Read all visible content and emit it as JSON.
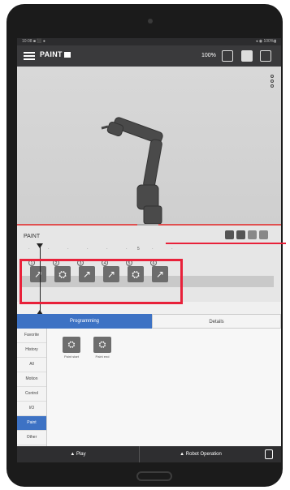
{
  "status_bar": {
    "left": "10:08 ■ ⬛ ●",
    "right": "◂ ◉ 100%▮"
  },
  "app": {
    "title": "PAINT",
    "zoom": "100%"
  },
  "paint_panel": {
    "label": "PAINT",
    "ruler_mark": "5"
  },
  "timeline_commands": [
    {
      "num": "1",
      "type": "move",
      "glyph": "↗"
    },
    {
      "num": "2",
      "type": "paint-start",
      "glyph": "⛭"
    },
    {
      "num": "3",
      "type": "move",
      "glyph": "↗"
    },
    {
      "num": "4",
      "type": "move",
      "glyph": "↗"
    },
    {
      "num": "5",
      "type": "paint-end",
      "glyph": "⛭"
    },
    {
      "num": "6",
      "type": "move",
      "glyph": "↗"
    }
  ],
  "tabs": {
    "programming": "Programming",
    "details": "Details"
  },
  "categories": [
    "Favorite",
    "History",
    "All",
    "Motion",
    "Control",
    "I/O",
    "Paint",
    "Other"
  ],
  "active_category": "Paint",
  "palette": [
    {
      "label": "Paint start",
      "glyph": "⛭"
    },
    {
      "label": "Paint end",
      "glyph": "⛭"
    }
  ],
  "bottom_bar": {
    "play": "▲ Play",
    "robot_operation": "▲ Robot Operation"
  },
  "colors": {
    "accent_blue": "#3d72c4",
    "highlight_red": "#e8213a",
    "title_bar": "#3a3a3c"
  }
}
